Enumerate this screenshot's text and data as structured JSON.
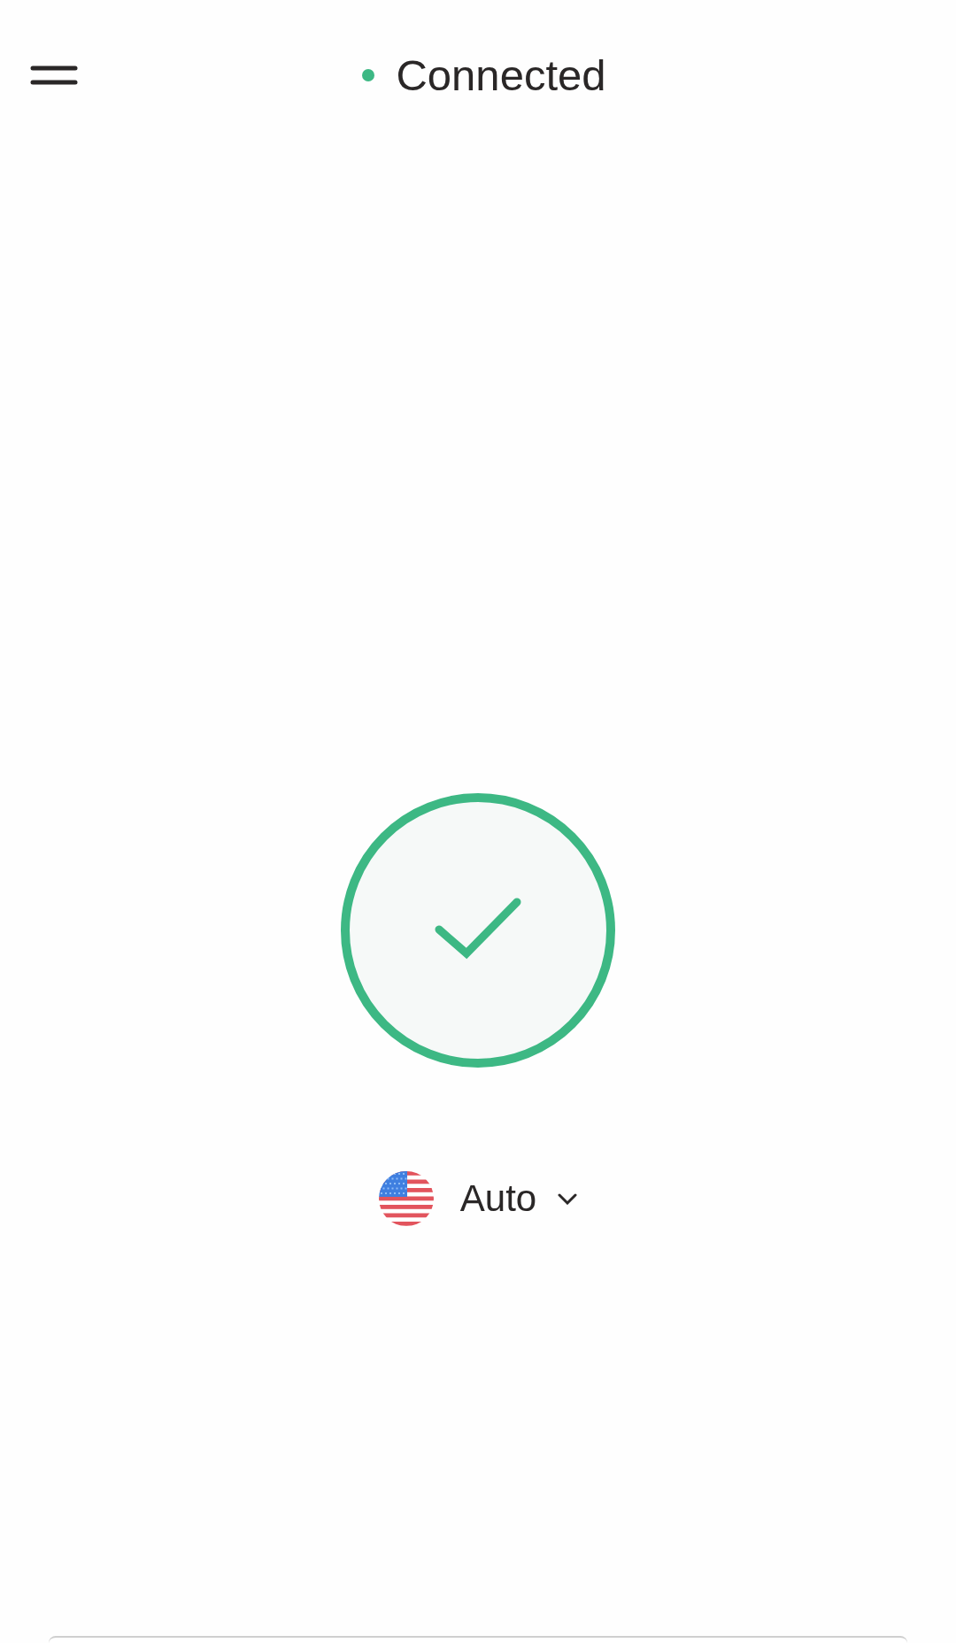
{
  "header": {
    "status": {
      "label": "Connected",
      "connected": true
    }
  },
  "connect_button": {
    "connected": true
  },
  "location": {
    "label": "Auto"
  }
}
